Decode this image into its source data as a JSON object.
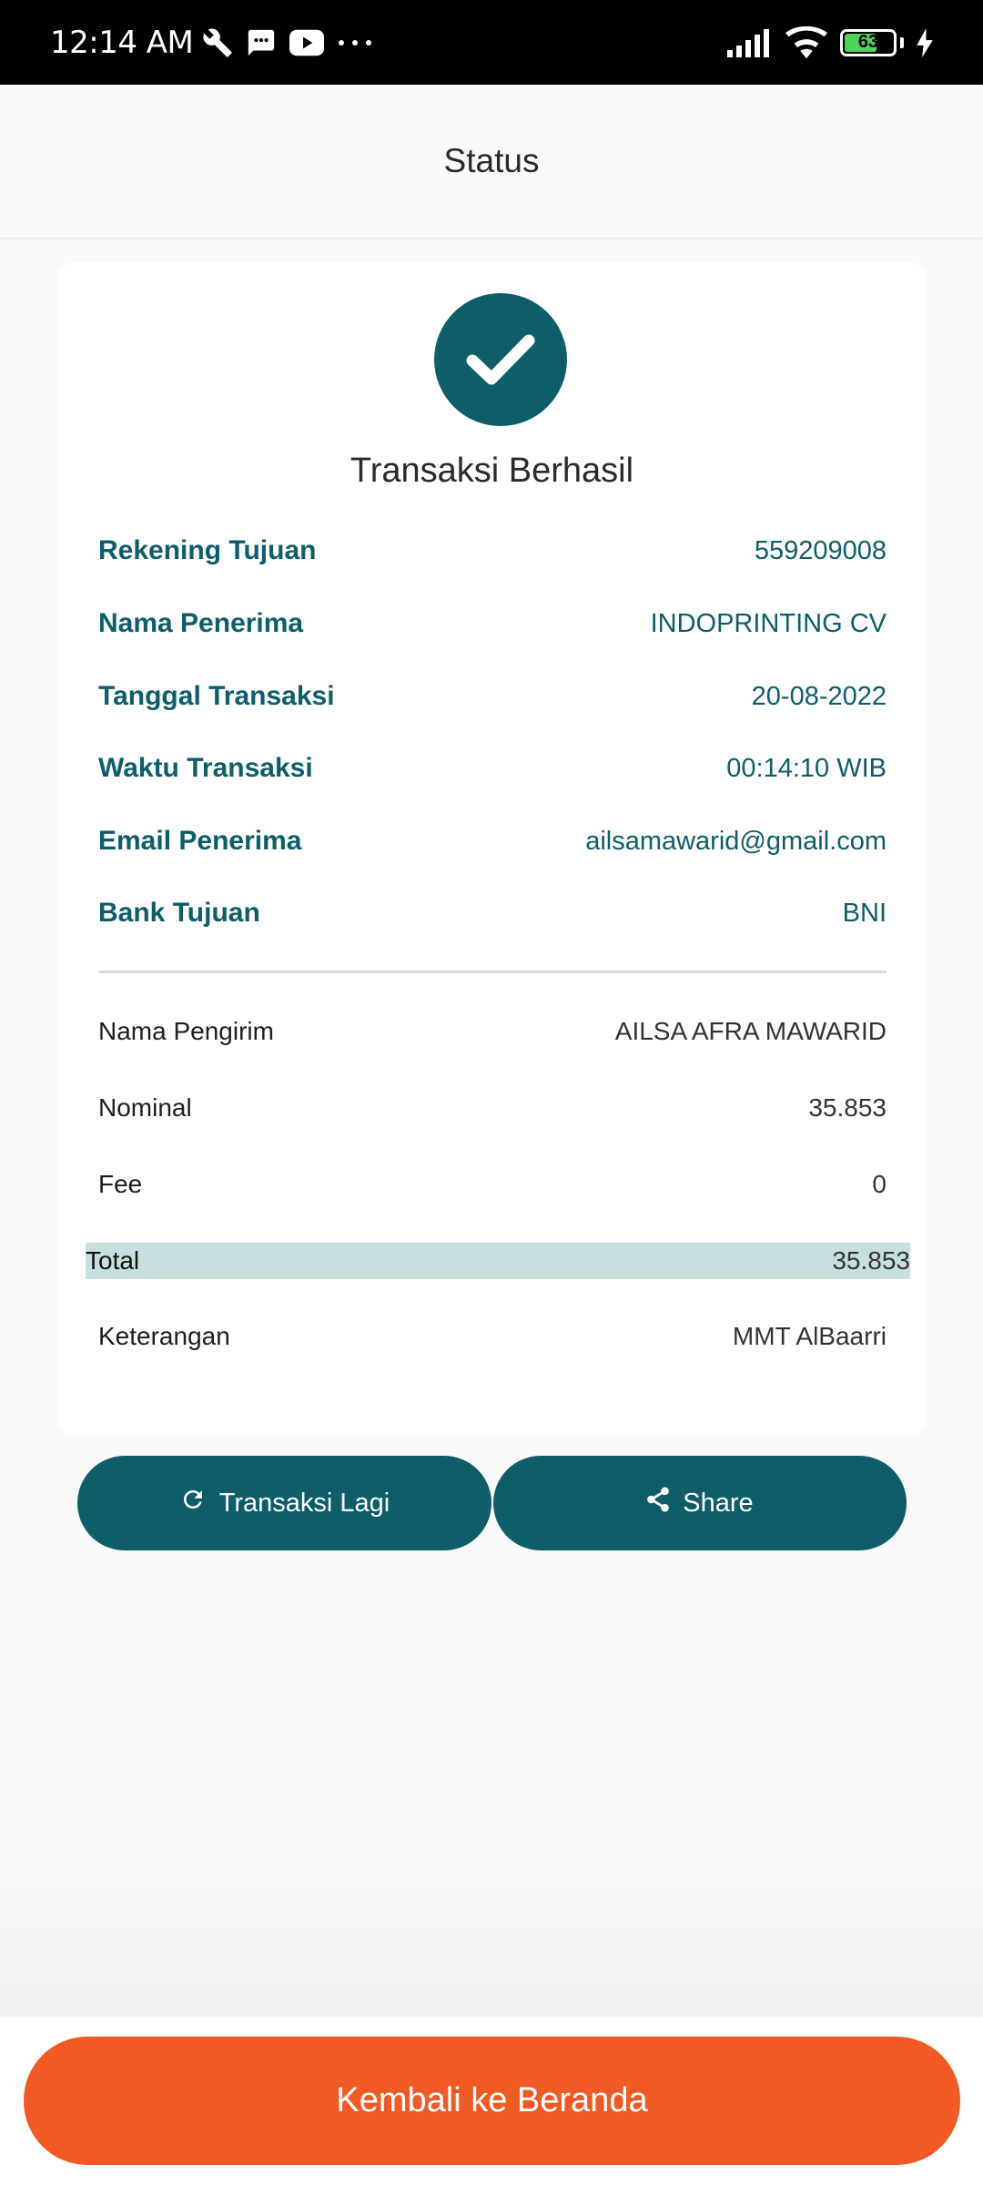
{
  "status_bar": {
    "time": "12:14 AM",
    "battery": "63"
  },
  "header": {
    "title": "Status"
  },
  "card": {
    "title": "Transaksi Berhasil",
    "details": [
      {
        "label": "Rekening Tujuan",
        "value": "559209008"
      },
      {
        "label": "Nama Penerima",
        "value": "INDOPRINTING CV"
      },
      {
        "label": "Tanggal Transaksi",
        "value": "20-08-2022"
      },
      {
        "label": "Waktu Transaksi",
        "value": "00:14:10 WIB"
      },
      {
        "label": "Email Penerima",
        "value": "ailsamawarid@gmail.com"
      },
      {
        "label": "Bank Tujuan",
        "value": "BNI"
      }
    ],
    "sender": {
      "label": "Nama Pengirim",
      "value": "AILSA AFRA MAWARID"
    },
    "nominal": {
      "label": "Nominal",
      "value": "35.853"
    },
    "fee": {
      "label": "Fee",
      "value": "0"
    },
    "total": {
      "label": "Total",
      "value": "35.853"
    },
    "note": {
      "label": "Keterangan",
      "value": "MMT AlBaarri"
    }
  },
  "actions": {
    "again_label": "Transaksi Lagi",
    "share_label": "Share",
    "home_label": "Kembali ke Beranda"
  },
  "colors": {
    "primary": "#0e5d68",
    "accent": "#f15a24",
    "total_highlight": "#c8dfe0"
  },
  "icons": [
    "wrench-icon",
    "message-icon",
    "youtube-icon",
    "more-icon",
    "signal-icon",
    "wifi-icon",
    "battery-icon",
    "charging-icon",
    "check-icon",
    "refresh-icon",
    "share-icon"
  ]
}
